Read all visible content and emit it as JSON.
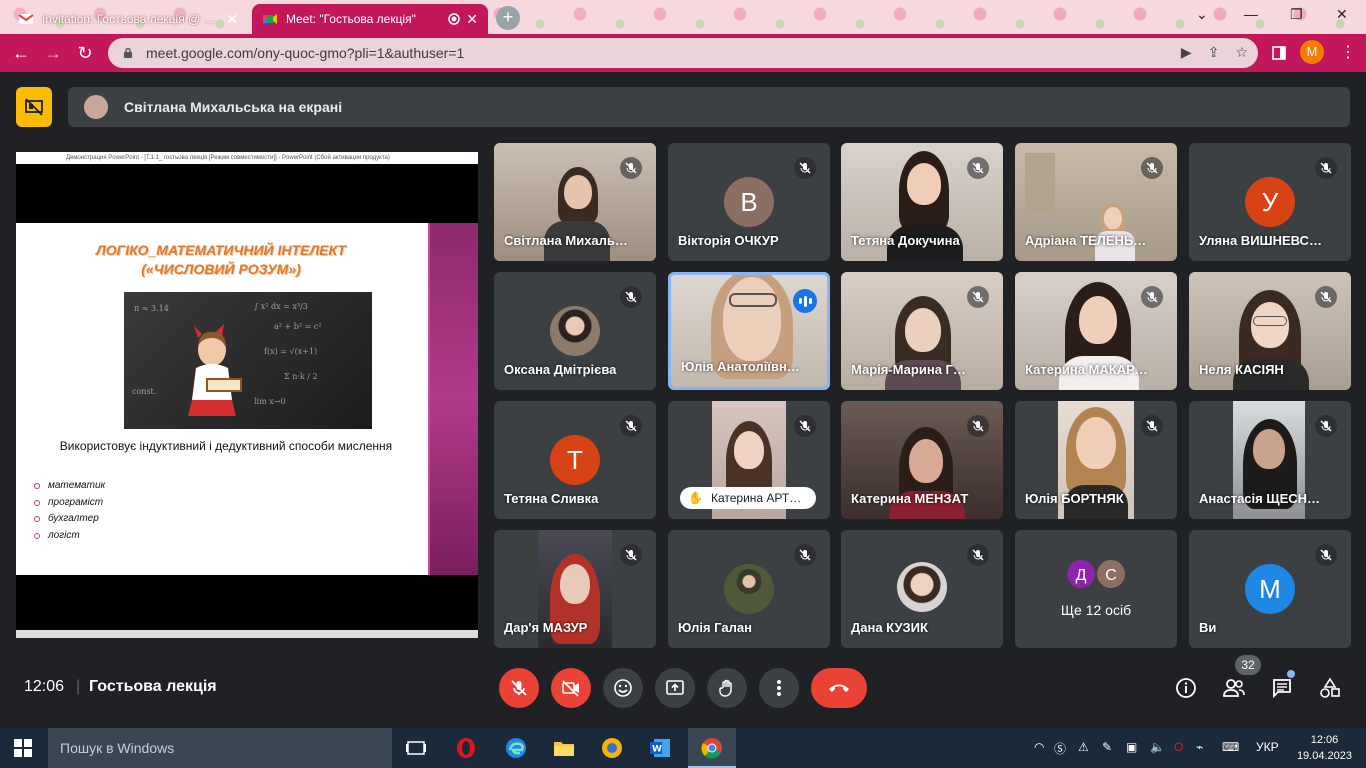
{
  "browser": {
    "tabs": [
      {
        "title": "Invitation: Гостьова лекція @ We",
        "active": false
      },
      {
        "title": "Meet: \"Гостьова лекція\"",
        "active": true
      }
    ],
    "url": "meet.google.com/ony-quoc-gmo?pli=1&authuser=1",
    "profile_letter": "M",
    "accent": "#c2185b"
  },
  "presenting": {
    "text": "Світлана Михальська на екрані"
  },
  "shared_screen": {
    "window_title": "Демонстрация PowerPoint - [Т.1.1_ гостьова лекція [Режим совместимости]] - PowerPoint (Сбой активации продукта)",
    "slide_title_line1": "ЛОГІКО_МАТЕМАТИЧНИЙ ІНТЕЛЕКТ",
    "slide_title_line2": "(«ЧИСЛОВИЙ РОЗУМ»)",
    "caption": "Використовує індуктивний і дедуктивний способи мислення",
    "items": [
      "математик",
      "програміст",
      "бухгалтер",
      "логіст"
    ]
  },
  "participants": [
    {
      "name": "Світлана Михаль…",
      "kind": "video"
    },
    {
      "name": "Вікторія ОЧКУР",
      "kind": "letter",
      "letter": "В",
      "color": "#8d6e63"
    },
    {
      "name": "Тетяна Докучина",
      "kind": "video"
    },
    {
      "name": "Адріана ТЕЛЕНЬ…",
      "kind": "video"
    },
    {
      "name": "Уляна ВИШНЕВС…",
      "kind": "letter",
      "letter": "У",
      "color": "#d84315"
    },
    {
      "name": "Оксана Дмітрієва",
      "kind": "photo"
    },
    {
      "name": "Юлія Анатоліївн…",
      "kind": "video",
      "speaking": true
    },
    {
      "name": "Марія-Марина Г…",
      "kind": "video"
    },
    {
      "name": "Катерина МАКАР…",
      "kind": "video"
    },
    {
      "name": "Неля КАСІЯН",
      "kind": "video"
    },
    {
      "name": "Тетяна Сливка",
      "kind": "letter",
      "letter": "Т",
      "color": "#d84315"
    },
    {
      "name": "Катерина АРТ…",
      "kind": "video",
      "hand": true
    },
    {
      "name": "Катерина МЕНЗАТ",
      "kind": "video"
    },
    {
      "name": "Юлія БОРТНЯК",
      "kind": "video"
    },
    {
      "name": "Анастасія ЩЕСН…",
      "kind": "video"
    },
    {
      "name": "Дар'я МАЗУР",
      "kind": "video"
    },
    {
      "name": "Юлія Галан",
      "kind": "photo"
    },
    {
      "name": "Дана КУЗИК",
      "kind": "photo"
    },
    {
      "name": "Ще 12 осіб",
      "kind": "more",
      "avatars": [
        "Д",
        "С"
      ]
    },
    {
      "name": "Ви",
      "kind": "letter",
      "letter": "M",
      "color": "#1e88e5"
    }
  ],
  "controls": {
    "time": "12:06",
    "separator": "|",
    "meeting_name": "Гостьова лекція",
    "participant_count": "32"
  },
  "taskbar": {
    "search_placeholder": "Пошук в Windows",
    "lang": "УКР",
    "time": "12:06",
    "date": "19.04.2023"
  }
}
